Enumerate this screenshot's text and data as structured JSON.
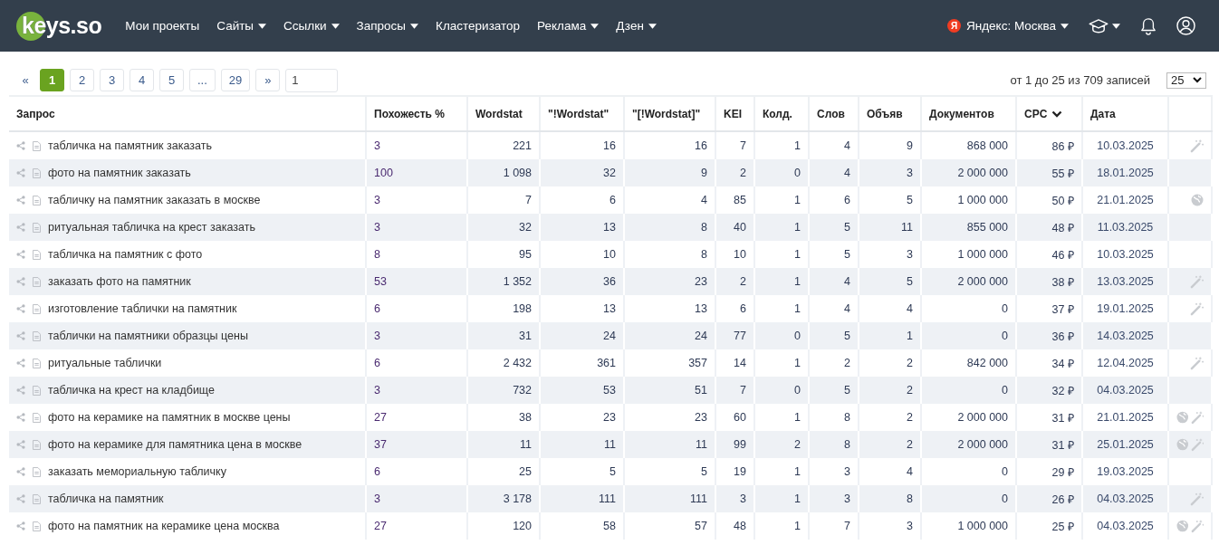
{
  "header": {
    "logo": "keys.so",
    "nav": [
      {
        "label": "Мои проекты",
        "dropdown": false
      },
      {
        "label": "Сайты",
        "dropdown": true
      },
      {
        "label": "Ссылки",
        "dropdown": true
      },
      {
        "label": "Запросы",
        "dropdown": true
      },
      {
        "label": "Кластеризатор",
        "dropdown": false
      },
      {
        "label": "Реклама",
        "dropdown": true
      },
      {
        "label": "Дзен",
        "dropdown": true
      }
    ],
    "region": {
      "badge": "Я",
      "label": "Яндекс: Москва"
    }
  },
  "pagination": {
    "pages": [
      {
        "label": "«",
        "selected": false,
        "kind": "arrow"
      },
      {
        "label": "1",
        "selected": true,
        "kind": "page"
      },
      {
        "label": "2",
        "selected": false,
        "kind": "page"
      },
      {
        "label": "3",
        "selected": false,
        "kind": "page"
      },
      {
        "label": "4",
        "selected": false,
        "kind": "page"
      },
      {
        "label": "5",
        "selected": false,
        "kind": "page"
      },
      {
        "label": "...",
        "selected": false,
        "kind": "page"
      },
      {
        "label": "29",
        "selected": false,
        "kind": "page"
      },
      {
        "label": "»",
        "selected": false,
        "kind": "page"
      }
    ],
    "page_input": "1",
    "summary": "от 1 до 25 из 709 записей",
    "per_page": "25"
  },
  "table": {
    "columns": [
      {
        "label": "Запрос",
        "sorted": false
      },
      {
        "label": "Похожесть %",
        "sorted": false
      },
      {
        "label": "Wordstat",
        "sorted": false
      },
      {
        "label": "\"!Wordstat\"",
        "sorted": false
      },
      {
        "label": "\"[!Wordstat]\"",
        "sorted": false
      },
      {
        "label": "KEI",
        "sorted": false
      },
      {
        "label": "Колд.",
        "sorted": false
      },
      {
        "label": "Слов",
        "sorted": false
      },
      {
        "label": "Объяв",
        "sorted": false
      },
      {
        "label": "Документов",
        "sorted": false
      },
      {
        "label": "CPC",
        "sorted": true
      },
      {
        "label": "Дата",
        "sorted": false
      }
    ],
    "rows": [
      {
        "cells": [
          "табличка на памятник заказать",
          "3",
          "221",
          "16",
          "16",
          "7",
          "1",
          "4",
          "9",
          "868 000",
          "86 ₽",
          "10.03.2025"
        ],
        "globe": false,
        "wand": true
      },
      {
        "cells": [
          "фото на памятник заказать",
          "100",
          "1 098",
          "32",
          "9",
          "2",
          "0",
          "4",
          "3",
          "2 000 000",
          "55 ₽",
          "18.01.2025"
        ],
        "globe": false,
        "wand": false
      },
      {
        "cells": [
          "табличку на памятник заказать в москве",
          "3",
          "7",
          "6",
          "4",
          "85",
          "1",
          "6",
          "5",
          "1 000 000",
          "50 ₽",
          "21.01.2025"
        ],
        "globe": true,
        "wand": false
      },
      {
        "cells": [
          "ритуальная табличка на крест заказать",
          "3",
          "32",
          "13",
          "8",
          "40",
          "1",
          "5",
          "11",
          "855 000",
          "48 ₽",
          "11.03.2025"
        ],
        "globe": false,
        "wand": false
      },
      {
        "cells": [
          "табличка на памятник с фото",
          "8",
          "95",
          "10",
          "8",
          "10",
          "1",
          "5",
          "3",
          "1 000 000",
          "46 ₽",
          "10.03.2025"
        ],
        "globe": false,
        "wand": false
      },
      {
        "cells": [
          "заказать фото на памятник",
          "53",
          "1 352",
          "36",
          "23",
          "2",
          "1",
          "4",
          "5",
          "2 000 000",
          "38 ₽",
          "13.03.2025"
        ],
        "globe": false,
        "wand": true
      },
      {
        "cells": [
          "изготовление таблички на памятник",
          "6",
          "198",
          "13",
          "13",
          "6",
          "1",
          "4",
          "4",
          "0",
          "37 ₽",
          "19.01.2025"
        ],
        "globe": false,
        "wand": true
      },
      {
        "cells": [
          "таблички на памятники образцы цены",
          "3",
          "31",
          "24",
          "24",
          "77",
          "0",
          "5",
          "1",
          "0",
          "36 ₽",
          "14.03.2025"
        ],
        "globe": false,
        "wand": false
      },
      {
        "cells": [
          "ритуальные таблички",
          "6",
          "2 432",
          "361",
          "357",
          "14",
          "1",
          "2",
          "2",
          "842 000",
          "34 ₽",
          "12.04.2025"
        ],
        "globe": false,
        "wand": true
      },
      {
        "cells": [
          "табличка на крест на кладбище",
          "3",
          "732",
          "53",
          "51",
          "7",
          "0",
          "5",
          "2",
          "0",
          "32 ₽",
          "04.03.2025"
        ],
        "globe": false,
        "wand": false
      },
      {
        "cells": [
          "фото на керамике на памятник в москве цены",
          "27",
          "38",
          "23",
          "23",
          "60",
          "1",
          "8",
          "2",
          "2 000 000",
          "31 ₽",
          "21.01.2025"
        ],
        "globe": true,
        "wand": true
      },
      {
        "cells": [
          "фото на керамике для памятника цена в москве",
          "37",
          "11",
          "11",
          "11",
          "99",
          "2",
          "8",
          "2",
          "2 000 000",
          "31 ₽",
          "25.01.2025"
        ],
        "globe": true,
        "wand": true
      },
      {
        "cells": [
          "заказать мемориальную табличку",
          "6",
          "25",
          "5",
          "5",
          "19",
          "1",
          "3",
          "4",
          "0",
          "29 ₽",
          "19.03.2025"
        ],
        "globe": false,
        "wand": false
      },
      {
        "cells": [
          "табличка на памятник",
          "3",
          "3 178",
          "111",
          "111",
          "3",
          "1",
          "3",
          "8",
          "0",
          "26 ₽",
          "04.03.2025"
        ],
        "globe": false,
        "wand": true
      },
      {
        "cells": [
          "фото на памятник на керамике цена москва",
          "27",
          "120",
          "58",
          "57",
          "48",
          "1",
          "7",
          "3",
          "1 000 000",
          "25 ₽",
          "04.03.2025"
        ],
        "globe": true,
        "wand": true
      }
    ]
  }
}
